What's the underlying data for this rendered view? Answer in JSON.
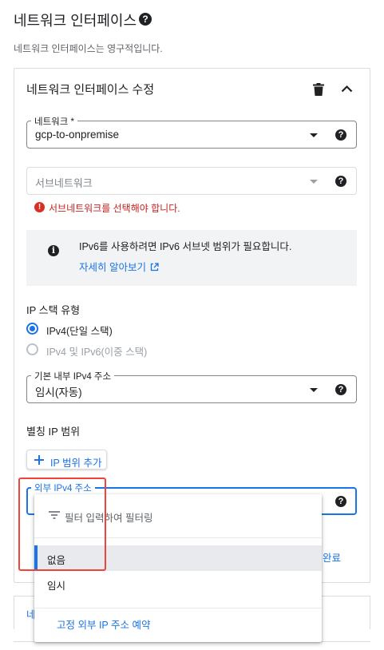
{
  "page": {
    "title": "네트워크 인터페이스",
    "subtitle": "네트워크 인터페이스는 영구적입니다."
  },
  "card": {
    "title": "네트워크 인터페이스 수정",
    "network": {
      "label": "네트워크 *",
      "value": "gcp-to-onpremise"
    },
    "subnetwork": {
      "placeholder": "서브네트워크",
      "error": "서브네트워크를 선택해야 합니다."
    },
    "info": {
      "text": "IPv6를 사용하려면 IPv6 서브넷 범위가 필요합니다.",
      "link": "자세히 알아보기"
    },
    "ip_stack": {
      "label": "IP 스택 유형",
      "options": [
        {
          "label": "IPv4(단일 스택)",
          "checked": true,
          "disabled": false
        },
        {
          "label": "IPv4 및 IPv6(이중 스택)",
          "checked": false,
          "disabled": true
        }
      ]
    },
    "internal_ipv4": {
      "label": "기본 내부 IPv4 주소",
      "value": "임시(자동)"
    },
    "alias": {
      "label": "별칭 IP 범위",
      "button": "IP 범위 추가"
    },
    "external_ipv4": {
      "label": "외부 IPv4 주소"
    },
    "done_button": "완료"
  },
  "card2": {
    "label": "네"
  },
  "dropdown": {
    "filter_placeholder": "필터 입력하여 필터링",
    "options": [
      "없음",
      "임시"
    ],
    "selected": "없음",
    "reserve_link": "고정 외부 IP 주소 예약"
  },
  "colors": {
    "accent": "#1a73e8",
    "error": "#d93025",
    "highlight_box": "#f04438"
  }
}
